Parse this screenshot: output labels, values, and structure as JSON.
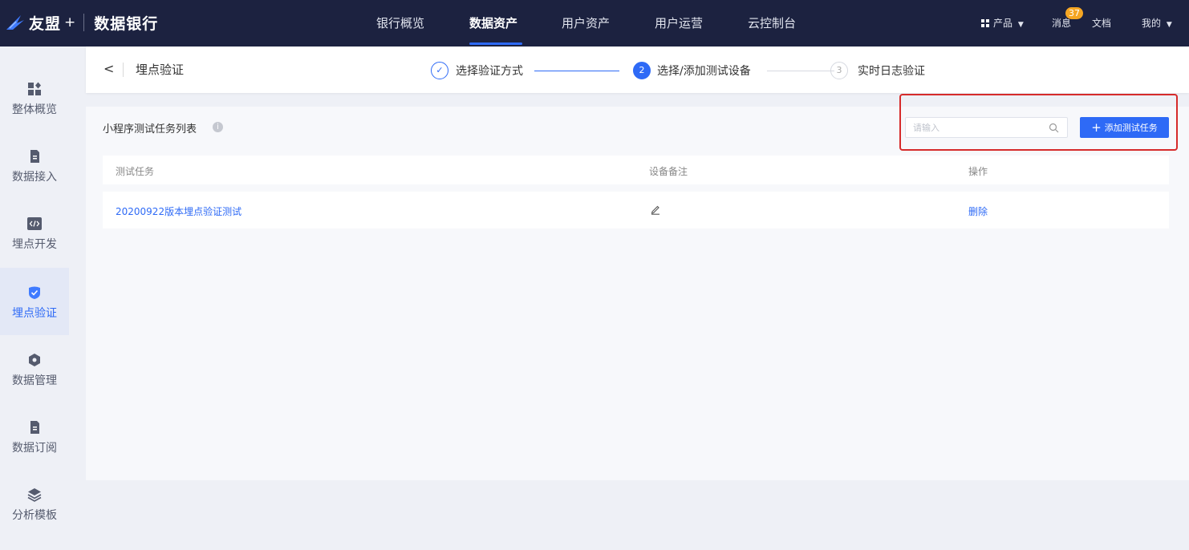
{
  "topbar": {
    "brand": "友盟",
    "brand_plus": "+",
    "app_name": "数据银行",
    "nav": [
      "银行概览",
      "数据资产",
      "用户资产",
      "用户运营",
      "云控制台"
    ],
    "active_nav": "数据资产",
    "products": "产品",
    "messages": "消息",
    "message_count": "37",
    "docs": "文档",
    "me": "我的"
  },
  "sidebar": {
    "items": [
      {
        "label": "整体概览",
        "icon": "dashboard-icon"
      },
      {
        "label": "数据接入",
        "icon": "document-icon"
      },
      {
        "label": "埋点开发",
        "icon": "code-icon"
      },
      {
        "label": "埋点验证",
        "icon": "shield-check-icon",
        "active": true
      },
      {
        "label": "数据管理",
        "icon": "hexagon-icon"
      },
      {
        "label": "数据订阅",
        "icon": "document-icon"
      },
      {
        "label": "分析模板",
        "icon": "layers-icon"
      }
    ]
  },
  "header": {
    "back": "<",
    "title": "埋点验证",
    "steps": [
      {
        "num": "✓",
        "label": "选择验证方式",
        "state": "done"
      },
      {
        "num": "2",
        "label": "选择/添加测试设备",
        "state": "active"
      },
      {
        "num": "3",
        "label": "实时日志验证",
        "state": "pending"
      }
    ]
  },
  "card": {
    "title": "小程序测试任务列表",
    "info": "i",
    "search_placeholder": "请输入",
    "add_button": "添加测试任务",
    "columns": [
      "测试任务",
      "设备备注",
      "操作"
    ],
    "rows": [
      {
        "task": "20200922版本埋点验证测试",
        "note": "",
        "action": "删除"
      }
    ]
  },
  "colors": {
    "nav_bg": "#1c2240",
    "accent": "#2e6af6",
    "highlight": "#d62b2b",
    "badge": "#f5a623"
  }
}
